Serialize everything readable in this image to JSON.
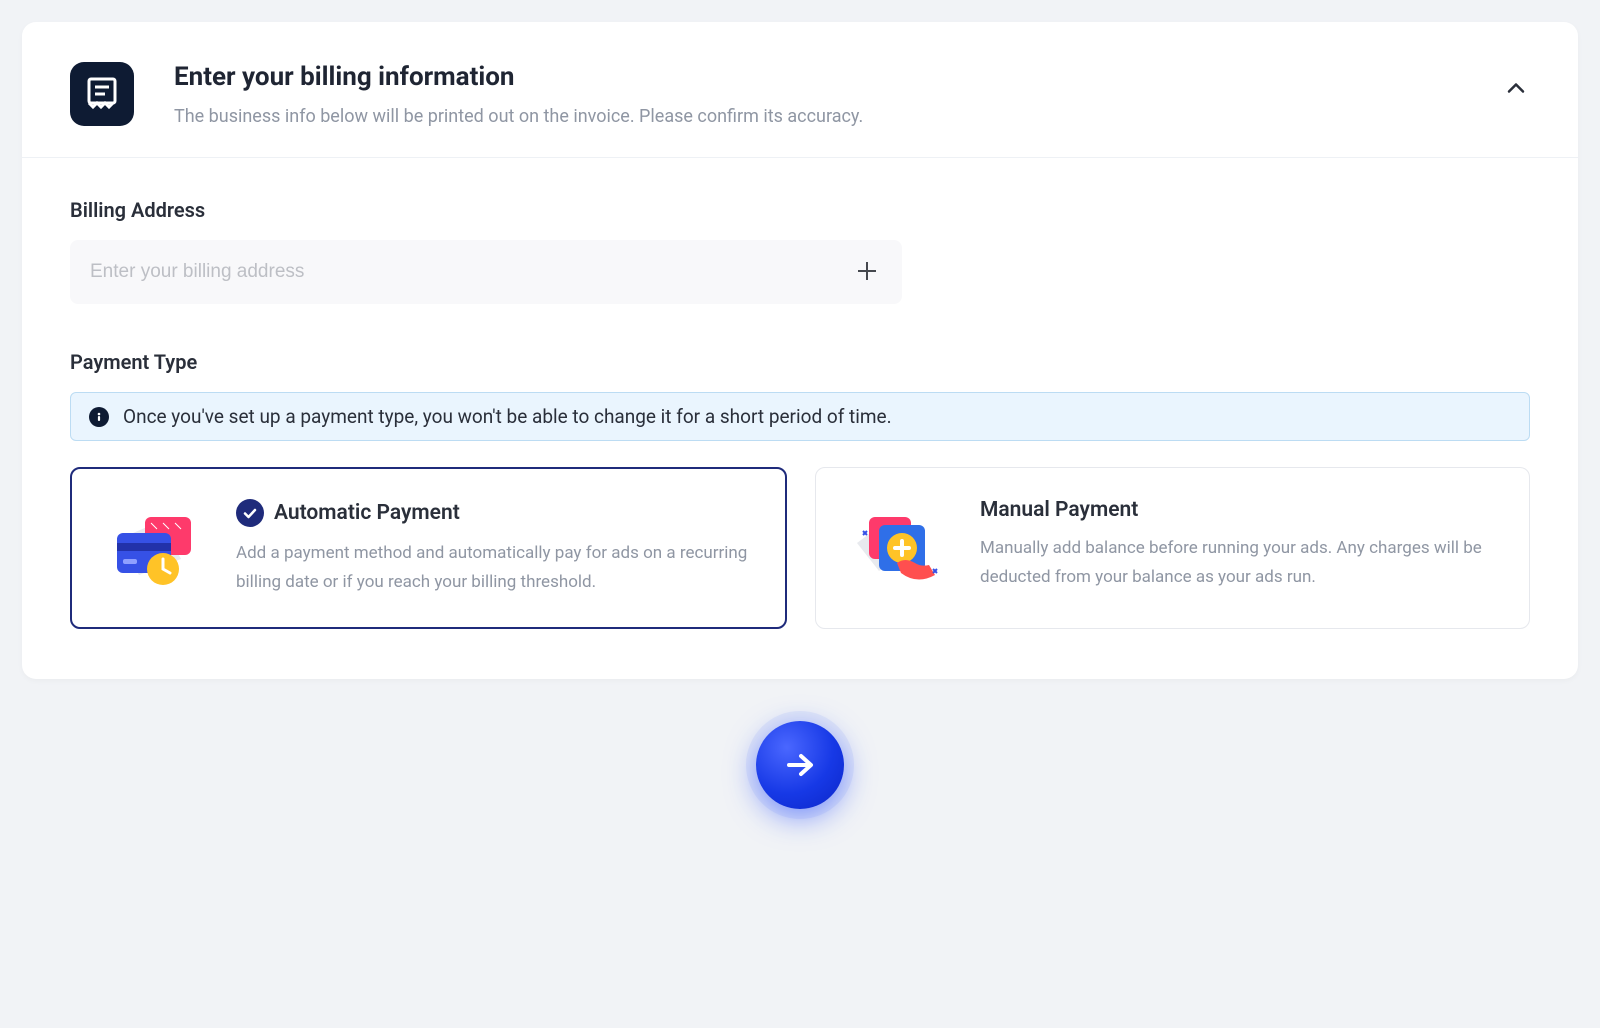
{
  "header": {
    "title": "Enter your billing information",
    "subtitle": "The business info below will be printed out on the invoice. Please confirm its accuracy."
  },
  "billing": {
    "label": "Billing Address",
    "placeholder": "Enter your billing address",
    "value": ""
  },
  "payment": {
    "label": "Payment Type",
    "info": "Once you've set up a payment type, you won't be able to change it for a short period of time.",
    "options": [
      {
        "title": "Automatic Payment",
        "desc": "Add a payment method and automatically pay for ads on a recurring billing date or if you reach your billing threshold.",
        "selected": true
      },
      {
        "title": "Manual Payment",
        "desc": "Manually add balance before running your ads. Any charges will be deducted from your balance as your ads run.",
        "selected": false
      }
    ]
  }
}
